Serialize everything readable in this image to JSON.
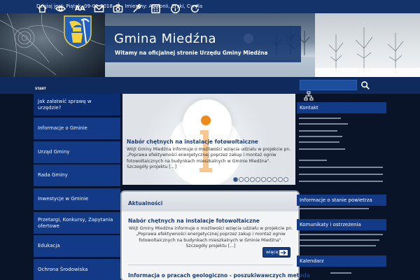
{
  "topbar": {
    "date_text": "Dzisiaj jest: Piątek, 09-02-2018",
    "nameday_text": "Imieniny: Apolonii, Eryki, Cyryla"
  },
  "banner": {
    "title": "Gmina Miedźna",
    "subtitle": "Witamy na oficjalnej stronie Urzędu Gminy Miedźna"
  },
  "toolbar": {
    "start_label": "START",
    "font_size_label": "AA",
    "search_placeholder": ""
  },
  "nav": {
    "items": [
      "Jak załatwić sprawę w urzędzie?",
      "Informacje o Gminie",
      "Urząd Gminy",
      "Rada Gminy",
      "Inwestycje w Gminie",
      "Przetargi, Konkursy, Zapytania ofertowe",
      "Edukacja",
      "Ochrona Środowiska"
    ]
  },
  "slider": {
    "title": "Nabór chętnych na instalacje fotowoltaiczne",
    "text": "Wójt Gminy Miedźna informuje o możliwości wzięcia udziału w projekcie pn. „Poprawa efektywności energetycznej poprzez zakup i montaż ogniw fotowoltaicznych na budynkach mieszkalnych w Gminie Miedźna\". Szczegóły projektu [...]",
    "dot_count": 10,
    "active_dot": 0
  },
  "news": {
    "heading": "Aktualności",
    "items": [
      {
        "title": "Nabór chętnych na instalacje fotowoltaiczne",
        "text": "Wójt Gminy Miedźna informuje o możliwości wzięcia udziału w projekcie pn. „Poprawa efektywności energetycznej poprzez zakup i montaż ogniw fotowoltaicznych na budynkach mieszkalnych w Gminie Miedźna\". Szczegóły projektu [...]",
        "more_label": "więcej"
      },
      {
        "title": "Informacja o pracach geologiczno - poszukiwawczych metodą"
      }
    ]
  },
  "right": {
    "contact_heading": "Kontakt",
    "air_heading": "Informacje o stanie powietrza",
    "alerts_heading": "Komunikaty i ostrzeżenia",
    "calendar_heading": "Kalendarz"
  },
  "colors": {
    "nav_blue": "#123a86",
    "page_bg": "#0a1428",
    "title_blue": "#1d3f7a",
    "accent_orange": "#f08a16"
  }
}
